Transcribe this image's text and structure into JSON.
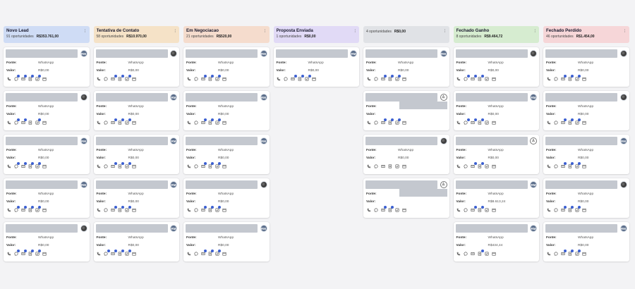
{
  "labels": {
    "source": "Fonte:",
    "value": "Valor:",
    "source_value": "WhatsApp",
    "amount_zero": "R$0,00"
  },
  "colors": {
    "card_bg": "#ffffff",
    "placeholder": "#c4c8cf",
    "badge": "#3b5fd1"
  },
  "columns": [
    {
      "title": "Novo Lead",
      "count": "91 oportunidades",
      "total": "R$353.761,00",
      "color": "#cfdcf5",
      "cards": [
        {
          "avatar": "RM",
          "avatar_type": "initials",
          "value": "R$0,00",
          "icons": [
            0,
            1,
            1,
            1,
            1,
            0
          ]
        },
        {
          "avatar": "",
          "avatar_type": "photo",
          "value": "R$0,00",
          "icons": [
            0,
            1,
            1,
            0,
            1,
            0
          ]
        },
        {
          "avatar": "RM",
          "avatar_type": "initials",
          "value": "R$0,00",
          "icons": [
            0,
            1,
            1,
            1,
            1,
            0
          ]
        },
        {
          "avatar": "RM",
          "avatar_type": "initials",
          "value": "R$0,00",
          "icons": [
            0,
            1,
            1,
            1,
            1,
            0
          ]
        },
        {
          "avatar": "",
          "avatar_type": "photo",
          "value": "R$0,00",
          "icons": [
            0,
            1,
            1,
            1,
            1,
            0
          ]
        }
      ]
    },
    {
      "title": "Tentativa de Contato",
      "count": "58 oportunidades",
      "total": "R$10.970,00",
      "color": "#f5e2c7",
      "cards": [
        {
          "avatar": "",
          "avatar_type": "photo",
          "value": "R$0,00",
          "icons": [
            0,
            0,
            1,
            1,
            1,
            0
          ]
        },
        {
          "avatar": "RM",
          "avatar_type": "initials",
          "value": "R$0,00",
          "icons": [
            0,
            0,
            1,
            1,
            1,
            0
          ]
        },
        {
          "avatar": "RM",
          "avatar_type": "initials",
          "value": "R$0,00",
          "icons": [
            0,
            0,
            1,
            1,
            1,
            0
          ]
        },
        {
          "avatar": "RM",
          "avatar_type": "initials",
          "value": "R$0,00",
          "icons": [
            0,
            0,
            1,
            1,
            1,
            0
          ]
        },
        {
          "avatar": "RM",
          "avatar_type": "initials",
          "value": "R$0,00",
          "icons": [
            0,
            1,
            1,
            1,
            1,
            0
          ]
        }
      ]
    },
    {
      "title": "Em Negociacao",
      "count": "21 oportunidades",
      "total": "R$520,00",
      "color": "#f5dccd",
      "cards": [
        {
          "avatar": "RM",
          "avatar_type": "initials",
          "value": "R$0,00",
          "icons": [
            0,
            0,
            1,
            1,
            1,
            0
          ]
        },
        {
          "avatar": "RM",
          "avatar_type": "initials",
          "value": "R$0,00",
          "icons": [
            0,
            0,
            1,
            1,
            1,
            0
          ]
        },
        {
          "avatar": "RM",
          "avatar_type": "initials",
          "value": "R$0,00",
          "icons": [
            0,
            0,
            1,
            1,
            1,
            0
          ]
        },
        {
          "avatar": "",
          "avatar_type": "photo",
          "value": "R$0,00",
          "icons": [
            0,
            0,
            1,
            1,
            1,
            0
          ]
        },
        {
          "avatar": "RM",
          "avatar_type": "initials",
          "value": "R$0,00",
          "icons": [
            0,
            0,
            1,
            1,
            1,
            0
          ]
        }
      ]
    },
    {
      "title": "Proposta Enviada",
      "count": "1 oportunidades",
      "total": "R$0,00",
      "color": "#e1daf6",
      "cards": [
        {
          "avatar": "RM",
          "avatar_type": "initials",
          "value": "R$0,00",
          "icons": [
            0,
            0,
            1,
            1,
            1,
            0
          ]
        }
      ]
    },
    {
      "title": "",
      "count": "4 oportunidades",
      "total": "R$0,00",
      "color": "#e0e2e6",
      "cards": [
        {
          "avatar": "RM",
          "avatar_type": "initials",
          "value": "R$0,00",
          "icons": [
            0,
            0,
            1,
            1,
            1,
            0
          ]
        },
        {
          "avatar": "",
          "avatar_type": "generic",
          "value": "",
          "icons": [
            0,
            0,
            1,
            1,
            1,
            0
          ],
          "value_hidden": true
        },
        {
          "avatar": "",
          "avatar_type": "photo",
          "value": "R$0,00",
          "icons": [
            0,
            0,
            0,
            0,
            0,
            0
          ]
        },
        {
          "avatar": "",
          "avatar_type": "generic",
          "value": "",
          "icons": [
            0,
            0,
            1,
            1,
            0,
            0
          ],
          "value_hidden": true
        }
      ]
    },
    {
      "title": "Fechado Ganho",
      "count": "8 oportunidades",
      "total": "R$9.464,72",
      "color": "#d6ecd0",
      "cards": [
        {
          "avatar": "",
          "avatar_type": "photo",
          "value": "R$0,00",
          "icons": [
            0,
            1,
            1,
            1,
            0,
            0
          ]
        },
        {
          "avatar": "RM",
          "avatar_type": "initials",
          "value": "R$0,00",
          "icons": [
            0,
            1,
            1,
            1,
            0,
            0
          ]
        },
        {
          "avatar": "",
          "avatar_type": "generic",
          "value": "R$0,00",
          "icons": [
            0,
            0,
            1,
            1,
            0,
            0
          ],
          "name_short": true
        },
        {
          "avatar": "RM",
          "avatar_type": "initials",
          "value": "R$8.613,24",
          "icons": [
            0,
            0,
            1,
            1,
            0,
            0
          ]
        },
        {
          "avatar": "RM",
          "avatar_type": "initials",
          "value": "R$434,44",
          "icons": [
            0,
            0,
            0,
            1,
            0,
            0
          ]
        }
      ]
    },
    {
      "title": "Fechado Perdido",
      "count": "46 oportunidades",
      "total": "R$1.454,00",
      "color": "#f6d6d8",
      "cards": [
        {
          "avatar": "",
          "avatar_type": "photo",
          "value": "R$0,00",
          "icons": [
            0,
            0,
            1,
            1,
            1,
            0
          ]
        },
        {
          "avatar": "",
          "avatar_type": "photo",
          "value": "R$0,00",
          "icons": [
            0,
            0,
            1,
            1,
            1,
            0
          ]
        },
        {
          "avatar": "RM",
          "avatar_type": "initials",
          "value": "R$0,00",
          "icons": [
            0,
            0,
            1,
            1,
            1,
            0
          ]
        },
        {
          "avatar": "",
          "avatar_type": "photo",
          "value": "R$0,00",
          "icons": [
            0,
            0,
            1,
            1,
            1,
            0
          ]
        },
        {
          "avatar": "RM",
          "avatar_type": "initials",
          "value": "R$0,00",
          "icons": [
            0,
            0,
            1,
            1,
            1,
            0
          ]
        }
      ]
    }
  ]
}
